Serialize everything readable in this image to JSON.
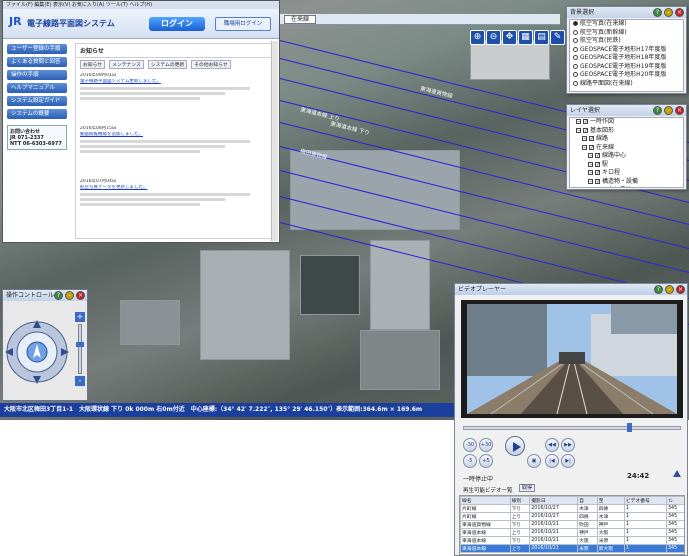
{
  "portal": {
    "browser_bar": "ファイル(F)  編集(E)  表示(V)  お気に入り(A)  ツール(T)  ヘルプ(H)",
    "logo_text": "電子線路平面図システム",
    "logo_sub": "JR",
    "login_label": "ログイン",
    "guest_login_label": "職場用ログイン",
    "sidebar": [
      {
        "label": "ユーザー登録の手順"
      },
      {
        "label": "よくある質問と回答"
      },
      {
        "label": "操作の手順"
      },
      {
        "label": "ヘルプマニュアル"
      },
      {
        "label": "システム設定ガイド"
      },
      {
        "label": "システムの概要"
      }
    ],
    "contact_title": "お問い合わせ",
    "contact_lines": [
      "JR 071-2337",
      "NTT 06-6303-6977"
    ],
    "notice_title": "お知らせ",
    "notice_tabs": [
      "お知らせ",
      "メンテナンス",
      "システムの更新",
      "その他お知らせ"
    ],
    "news": [
      {
        "date": "2016年09月01日",
        "text": "電子線路平面図システム更新しました。"
      },
      {
        "date": "2016年08月15日",
        "text": "動画閲覧機能を追加しました。"
      },
      {
        "date": "2016年07月04日",
        "text": "航空写真データを更新しました。"
      }
    ]
  },
  "map": {
    "status_text": "大阪市北区梅田3丁目1-1　大阪環状線 下り 0k 000m 右0m付近　中心座標:（34° 42′ 7.222″, 135° 29′ 46.150″）表示範囲:364.6m × 169.6m",
    "rail_labels": [
      "東海道本線 上り",
      "東海道本線 下り",
      "東海道貨物線",
      "梅田貨物線"
    ],
    "topbar_label": "在来線"
  },
  "background_panel": {
    "title": "背景選択",
    "items": [
      {
        "label": "航空写真(在来線)",
        "selected": true
      },
      {
        "label": "航空写真(新幹線)",
        "selected": false
      },
      {
        "label": "航空写真(民鉄)",
        "selected": false
      },
      {
        "label": "GEOSPACE電子地形H17年度版",
        "selected": false
      },
      {
        "label": "GEOSPACE電子地形H18年度版",
        "selected": false
      },
      {
        "label": "GEOSPACE電子地形H19年度版",
        "selected": false
      },
      {
        "label": "GEOSPACE電子地形H20年度版",
        "selected": false
      },
      {
        "label": "線路平面図(在来線)",
        "selected": false
      }
    ]
  },
  "layer_panel": {
    "title": "レイヤ選択",
    "items": [
      {
        "label": "一時作図",
        "indent": 1
      },
      {
        "label": "基本図形",
        "indent": 1
      },
      {
        "label": "線路",
        "indent": 2
      },
      {
        "label": "在来線",
        "indent": 2
      },
      {
        "label": "線路中心",
        "indent": 3
      },
      {
        "label": "駅",
        "indent": 3
      },
      {
        "label": "キロ程",
        "indent": 3
      },
      {
        "label": "構造物・設備",
        "indent": 3
      },
      {
        "label": "トンネル",
        "indent": 4
      }
    ]
  },
  "nav": {
    "title": "操作コントロール",
    "zoom_plus": "+",
    "zoom_minus": "-"
  },
  "player": {
    "title": "ビデオプレーヤー",
    "skip_buttons": [
      "-30",
      "+30",
      "-5",
      "+5"
    ],
    "status_label": "一時停止中",
    "time": "24:42",
    "list_label": "再生可能ビデオ一覧",
    "select_label": "取得",
    "columns": [
      "線名",
      "線別",
      "撮影日",
      "自",
      "至",
      "ビデオ番号",
      "ﾌﾚ"
    ],
    "rows": [
      [
        "片町線",
        "下り",
        "2016/10/27",
        "木津",
        "四條",
        "1",
        "345"
      ],
      [
        "片町線",
        "上り",
        "2016/10/27",
        "四條",
        "木津",
        "1",
        "345"
      ],
      [
        "東海道貨物線",
        "下り",
        "2016/10/21",
        "吹田",
        "神戸",
        "1",
        "345"
      ],
      [
        "東海道本線",
        "上り",
        "2016/10/21",
        "神戸",
        "大阪",
        "1",
        "345"
      ],
      [
        "東海道本線",
        "下り",
        "2016/10/21",
        "大阪",
        "米原",
        "1",
        "345"
      ],
      [
        "東海道本線",
        "上り",
        "2016/10/21",
        "米原",
        "新大阪",
        "1",
        "345"
      ]
    ],
    "selected_row": 5
  },
  "colors": {
    "rail": "#2a24d8",
    "statusbar": "#1b3f9c",
    "accent": "#1d4fa8"
  }
}
